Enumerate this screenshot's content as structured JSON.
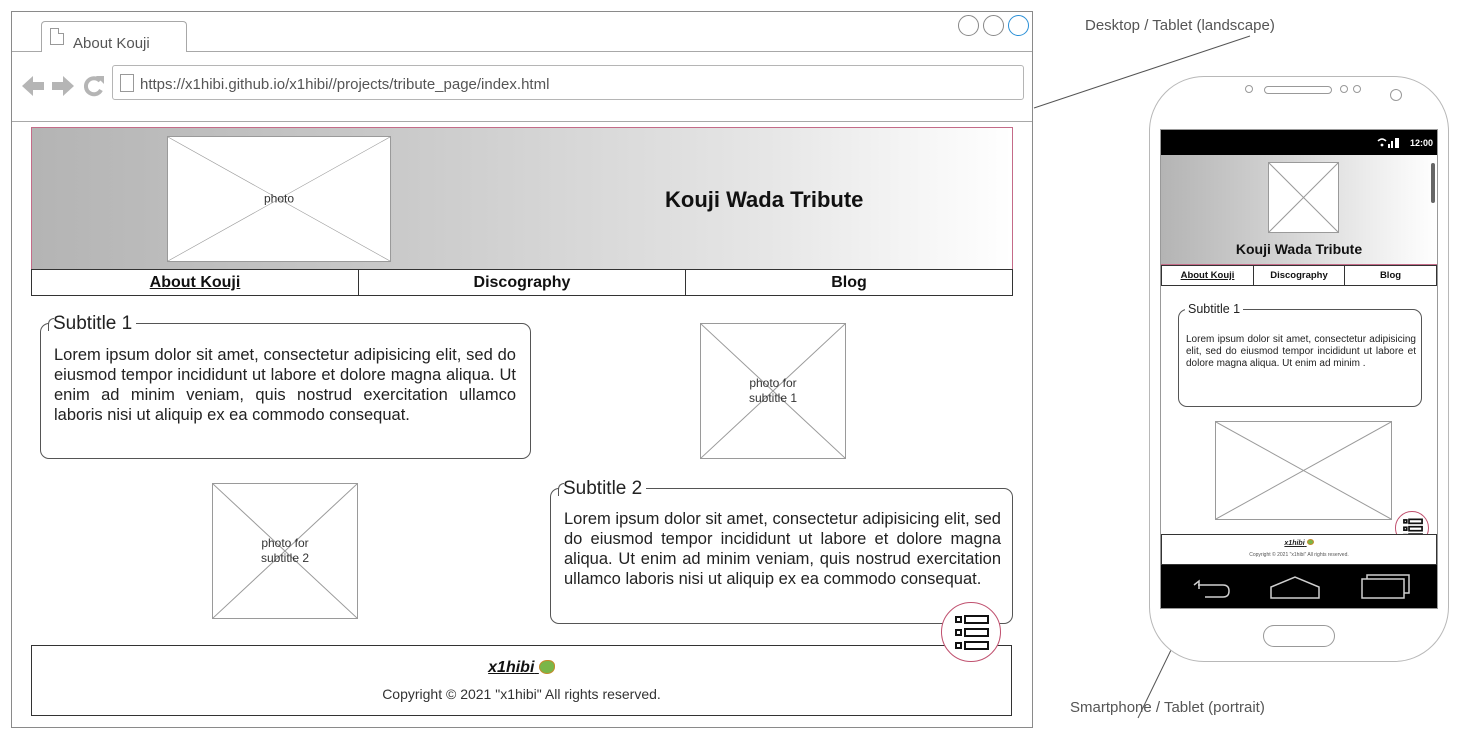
{
  "desktop": {
    "tab_title": "About Kouji",
    "url": "https://x1hibi.github.io/x1hibi//projects/tribute_page/index.html",
    "header_photo_caption": "photo",
    "page_title": "Kouji Wada Tribute",
    "nav": [
      "About Kouji",
      "Discography",
      "Blog"
    ],
    "section1": {
      "title": "Subtitle 1",
      "text": "Lorem ipsum dolor sit amet, consectetur adipisicing elit, sed do eiusmod tempor incididunt ut labore et dolore magna aliqua. Ut enim ad minim veniam, quis nostrud exercitation ullamco laboris nisi ut aliquip ex ea commodo consequat.",
      "photo_caption": "photo for subtitle 1"
    },
    "section2": {
      "title": "Subtitle 2",
      "text": "Lorem ipsum dolor sit amet, consectetur adipisicing elit, sed do eiusmod tempor incididunt ut labore et dolore magna aliqua. Ut enim ad minim veniam, quis nostrud exercitation ullamco laboris nisi ut aliquip ex ea commodo consequat.",
      "photo_caption": "photo for subtitle 2"
    },
    "footer": {
      "brand": "x1hibi",
      "copyright": "Copyright © 2021 \"x1hibi\"  All rights reserved."
    }
  },
  "labels": {
    "desktop": "Desktop / Tablet (landscape)",
    "mobile": "Smartphone / Tablet (portrait)"
  },
  "mobile": {
    "clock": "12:00",
    "page_title": "Kouji Wada Tribute",
    "nav": [
      "About Kouji",
      "Discography",
      "Blog"
    ],
    "section1": {
      "title": "Subtitle 1",
      "text": "Lorem ipsum dolor sit amet, consectetur adipisicing elit, sed do eiusmod tempor incididunt ut labore et dolore magna aliqua. Ut enim ad minim ."
    },
    "footer": {
      "brand": "x1hibi",
      "copyright": "Copyright © 2021 \"x1hibi\"  All rights reserved."
    }
  },
  "colors": {
    "accent_border": "#c46b88",
    "menu_circle": "#c0516f",
    "window_button_active": "#2a8fd6"
  }
}
